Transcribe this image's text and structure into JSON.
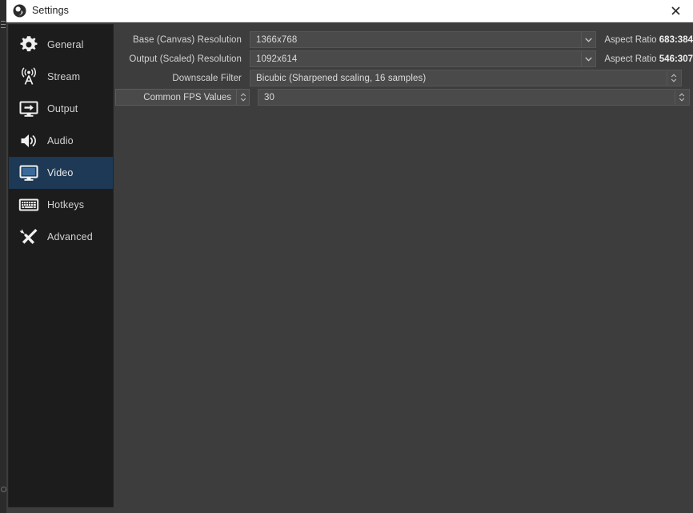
{
  "window": {
    "title": "Settings",
    "logo_icon": "obs-logo-icon",
    "close_icon": "close-icon"
  },
  "sidebar": {
    "items": [
      {
        "label": "General",
        "icon": "gear-icon",
        "selected": false
      },
      {
        "label": "Stream",
        "icon": "broadcast-tower-icon",
        "selected": false
      },
      {
        "label": "Output",
        "icon": "monitor-arrow-icon",
        "selected": false
      },
      {
        "label": "Audio",
        "icon": "speaker-icon",
        "selected": false
      },
      {
        "label": "Video",
        "icon": "monitor-icon",
        "selected": true
      },
      {
        "label": "Hotkeys",
        "icon": "keyboard-icon",
        "selected": false
      },
      {
        "label": "Advanced",
        "icon": "wrench-screwdriver-icon",
        "selected": false
      }
    ],
    "selected_highlight_color": "#1d3955"
  },
  "video_settings": {
    "rows": [
      {
        "label": "Base (Canvas) Resolution",
        "value": "1366x768",
        "control": "combobox",
        "dropdown_icon": "chevron-down-icon",
        "aspect_label": "Aspect Ratio",
        "aspect_value": "683:384"
      },
      {
        "label": "Output (Scaled) Resolution",
        "value": "1092x614",
        "control": "combobox",
        "dropdown_icon": "chevron-down-icon",
        "aspect_label": "Aspect Ratio",
        "aspect_value": "546:307"
      },
      {
        "label": "Downscale Filter",
        "value": "Bicubic (Sharpened scaling,  16 samples)",
        "control": "spinbox",
        "spinner_icon": "spinner-updown-icon"
      },
      {
        "label": "Common FPS Values",
        "value": "30",
        "control": "spinbox",
        "label_is_combobox": true,
        "label_spinner_icon": "spinner-updown-icon",
        "spinner_icon": "spinner-updown-icon"
      }
    ]
  },
  "theme": {
    "titlebar_background": "#ffffff",
    "titlebar_text": "#1d1d1d",
    "sidebar_background": "#1c1c1c",
    "content_background": "#3d3d3d",
    "field_background": "#4a4a4a",
    "field_text": "#dcdcdc",
    "label_text": "#d4d4d4"
  }
}
